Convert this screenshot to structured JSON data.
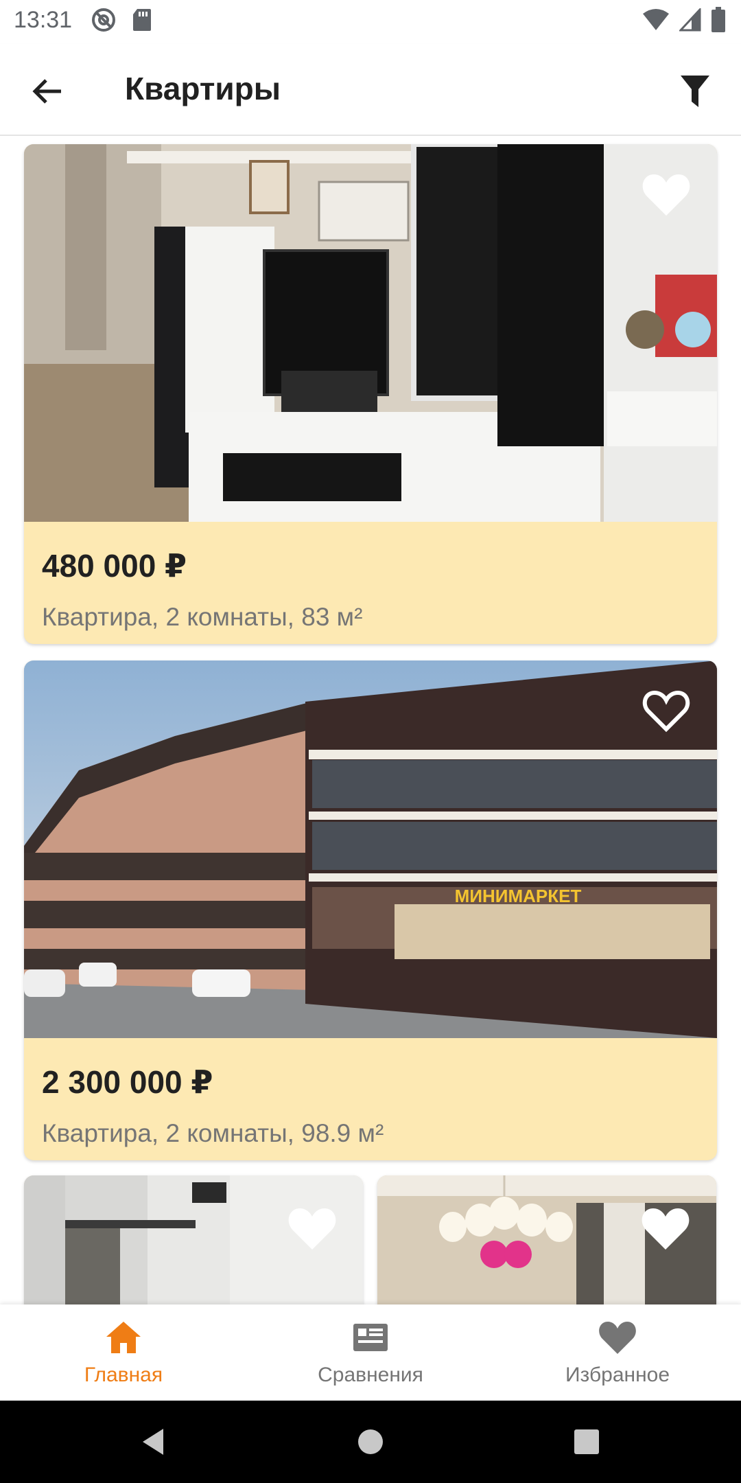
{
  "status_bar": {
    "time": "13:31"
  },
  "app_bar": {
    "title": "Квартиры"
  },
  "listings": [
    {
      "price": "480 000 ₽",
      "description": "Квартира, 2 комнаты, 83 м²",
      "favorite": true
    },
    {
      "price": "2 300 000 ₽",
      "description": "Квартира, 2 комнаты, 98.9 м²",
      "favorite": false,
      "sign": "МИНИМАРКЕТ"
    },
    {
      "price": "",
      "description": "",
      "favorite": true
    },
    {
      "price": "",
      "description": "",
      "favorite": true
    }
  ],
  "bottom_nav": {
    "items": [
      {
        "label": "Главная",
        "icon": "home-icon",
        "active": true
      },
      {
        "label": "Сравнения",
        "icon": "compare-icon",
        "active": false
      },
      {
        "label": "Избранное",
        "icon": "heart-icon",
        "active": false
      }
    ]
  },
  "colors": {
    "accent": "#ef7d15",
    "card_background": "#fde9b3",
    "inactive": "#757575"
  }
}
